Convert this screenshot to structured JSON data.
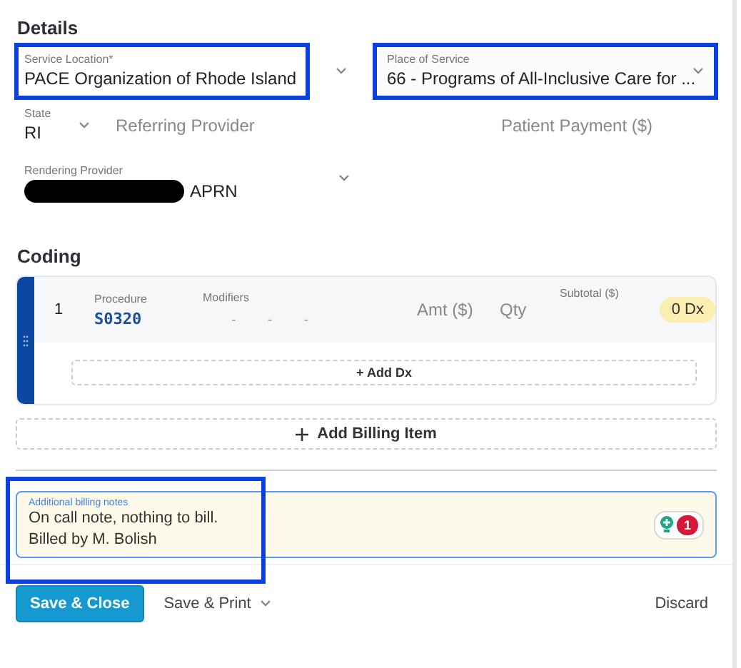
{
  "details": {
    "title": "Details",
    "service_location": {
      "label": "Service Location*",
      "value": "PACE Organization of Rhode Island",
      "annotated": true
    },
    "place_of_service": {
      "label": "Place of Service",
      "value": "66 - Programs of All-Inclusive Care for ...",
      "annotated": true
    },
    "state": {
      "label": "State",
      "value": "RI"
    },
    "referring_provider": {
      "placeholder": "Referring Provider"
    },
    "patient_payment": {
      "placeholder": "Patient Payment ($)"
    },
    "rendering_provider": {
      "label": "Rendering Provider",
      "value": "APRN",
      "redacted": true
    }
  },
  "coding": {
    "title": "Coding",
    "items": [
      {
        "number": "1",
        "procedure_label": "Procedure",
        "procedure": "S0320",
        "modifiers_label": "Modifiers",
        "modifiers": [
          "-",
          "-",
          "-"
        ],
        "amount_placeholder": "Amt ($)",
        "qty_placeholder": "Qty",
        "subtotal_label": "Subtotal ($)",
        "dx_badge": "0 Dx",
        "add_dx": "+ Add Dx"
      }
    ],
    "add_billing_item": "Add Billing Item"
  },
  "notes": {
    "label": "Additional billing notes",
    "lines": [
      "On call note, nothing to bill.",
      "Billed by M. Bolish"
    ],
    "annotated": true,
    "issue_count": "1"
  },
  "footer": {
    "save_close": "Save & Close",
    "save_print": "Save & Print",
    "discard": "Discard"
  }
}
